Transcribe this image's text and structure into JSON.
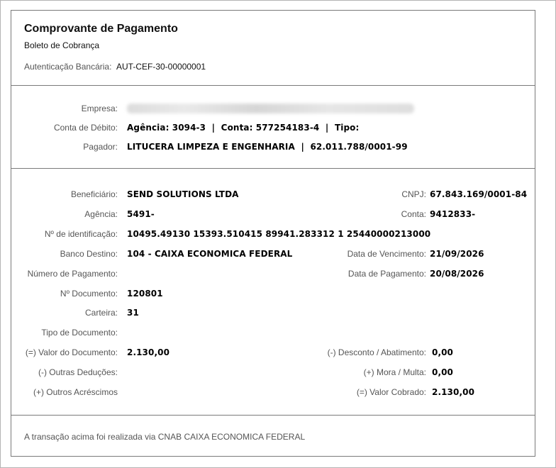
{
  "header": {
    "title": "Comprovante de Pagamento",
    "subtitle": "Boleto de Cobrança",
    "auth_label": "Autenticação Bancária:",
    "auth_value": "AUT-CEF-30-00000001"
  },
  "payer": {
    "empresa_label": "Empresa:",
    "conta_label": "Conta de Débito:",
    "conta_value": "Agência: 3094-3  |  Conta: 577254183-4  |  Tipo:",
    "pagador_label": "Pagador:",
    "pagador_value": "LITUCERA LIMPEZA E ENGENHARIA  |  62.011.788/0001-99"
  },
  "details": {
    "beneficiario_label": "Beneficiário:",
    "beneficiario_value": "SEND SOLUTIONS LTDA",
    "cnpj_label": "CNPJ:",
    "cnpj_value": "67.843.169/0001-84",
    "agencia_label": "Agência:",
    "agencia_value": "5491-",
    "conta_label": "Conta:",
    "conta_value": "9412833-",
    "ident_label": "Nº de identificação:",
    "ident_value": "10495.49130 15393.510415 89941.283312 1 25440000213000",
    "banco_label": "Banco Destino:",
    "banco_value": "104 - CAIXA ECONOMICA FEDERAL",
    "venc_label": "Data de Vencimento:",
    "venc_value": "21/09/2026",
    "numpag_label": "Número de Pagamento:",
    "datapag_label": "Data de Pagamento:",
    "datapag_value": "20/08/2026",
    "ndoc_label": "Nº Documento:",
    "ndoc_value": "120801",
    "carteira_label": "Carteira:",
    "carteira_value": "31",
    "tipodoc_label": "Tipo de Documento:",
    "valordoc_label": "(=) Valor do Documento:",
    "valordoc_value": "2.130,00",
    "desconto_label": "(-) Desconto / Abatimento:",
    "desconto_value": "0,00",
    "outrasded_label": "(-) Outras Deduções:",
    "mora_label": "(+) Mora / Multa:",
    "mora_value": "0,00",
    "outrosacr_label": "(+) Outros Acréscimos",
    "cobrado_label": "(=) Valor Cobrado:",
    "cobrado_value": "2.130,00"
  },
  "footer": {
    "text": "A transação acima foi realizada via CNAB CAIXA ECONOMICA FEDERAL"
  }
}
